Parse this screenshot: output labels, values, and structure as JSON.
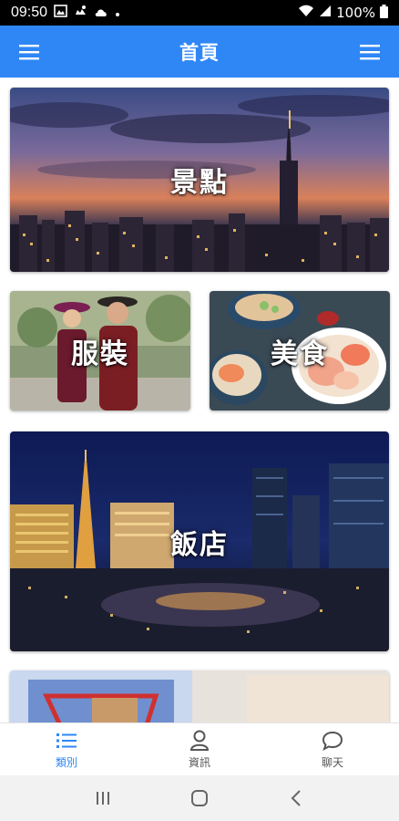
{
  "status_bar": {
    "time": "09:50",
    "left_icons": [
      "image-icon",
      "weather-icon",
      "cloud-icon",
      "dot-icon"
    ],
    "battery": "100%"
  },
  "app_bar": {
    "title": "首頁",
    "left_icon": "menu-icon",
    "right_icon": "menu-icon"
  },
  "categories": [
    {
      "id": "scenery",
      "label": "景點"
    },
    {
      "id": "clothing",
      "label": "服裝"
    },
    {
      "id": "food",
      "label": "美食"
    },
    {
      "id": "hotel",
      "label": "飯店"
    },
    {
      "id": "shopping",
      "label": ""
    }
  ],
  "bottom_nav": {
    "items": [
      {
        "label": "類別",
        "icon": "list-icon",
        "active": true
      },
      {
        "label": "資訊",
        "icon": "person-icon",
        "active": false
      },
      {
        "label": "聊天",
        "icon": "chat-icon",
        "active": false
      }
    ]
  },
  "system_nav": [
    "recent-apps-icon",
    "home-icon",
    "back-icon"
  ],
  "colors": {
    "primary": "#2f87f6",
    "status_bar": "#000000",
    "nav_inactive": "#555555"
  }
}
